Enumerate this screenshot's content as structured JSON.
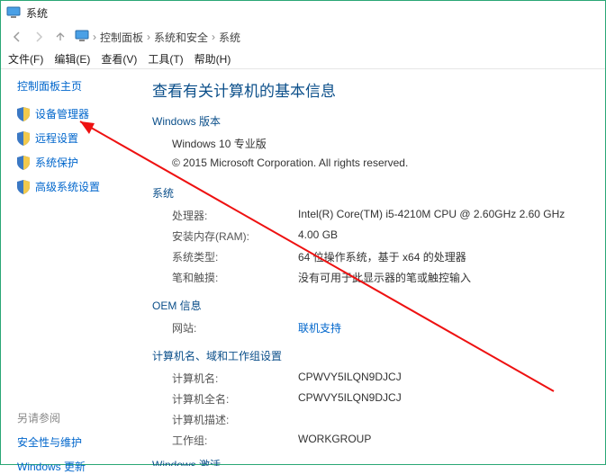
{
  "window": {
    "title": "系统"
  },
  "breadcrumb": {
    "root": "控制面板",
    "mid": "系统和安全",
    "leaf": "系统"
  },
  "menu": {
    "file": "文件(F)",
    "edit": "编辑(E)",
    "view": "查看(V)",
    "tools": "工具(T)",
    "help": "帮助(H)"
  },
  "sidebar": {
    "home": "控制面板主页",
    "items": [
      {
        "label": "设备管理器"
      },
      {
        "label": "远程设置"
      },
      {
        "label": "系统保护"
      },
      {
        "label": "高级系统设置"
      }
    ],
    "see_also_header": "另请参阅",
    "see_also": [
      {
        "label": "安全性与维护"
      },
      {
        "label": "Windows 更新"
      }
    ]
  },
  "content": {
    "title": "查看有关计算机的基本信息",
    "edition_header": "Windows 版本",
    "edition_value": "Windows 10 专业版",
    "copyright": "© 2015 Microsoft Corporation. All rights reserved.",
    "system_header": "系统",
    "system": {
      "processor_label": "处理器:",
      "processor_value": "Intel(R) Core(TM) i5-4210M CPU @ 2.60GHz   2.60 GHz",
      "ram_label": "安装内存(RAM):",
      "ram_value": "4.00 GB",
      "type_label": "系统类型:",
      "type_value": "64 位操作系统，基于 x64 的处理器",
      "pen_label": "笔和触摸:",
      "pen_value": "没有可用于此显示器的笔或触控输入"
    },
    "oem_header": "OEM 信息",
    "oem": {
      "site_label": "网站:",
      "site_value": "联机支持"
    },
    "domain_header": "计算机名、域和工作组设置",
    "domain": {
      "name_label": "计算机名:",
      "name_value": "CPWVY5ILQN9DJCJ",
      "full_label": "计算机全名:",
      "full_value": "CPWVY5ILQN9DJCJ",
      "desc_label": "计算机描述:",
      "desc_value": "",
      "workgroup_label": "工作组:",
      "workgroup_value": "WORKGROUP"
    },
    "activation_header": "Windows 激活"
  }
}
